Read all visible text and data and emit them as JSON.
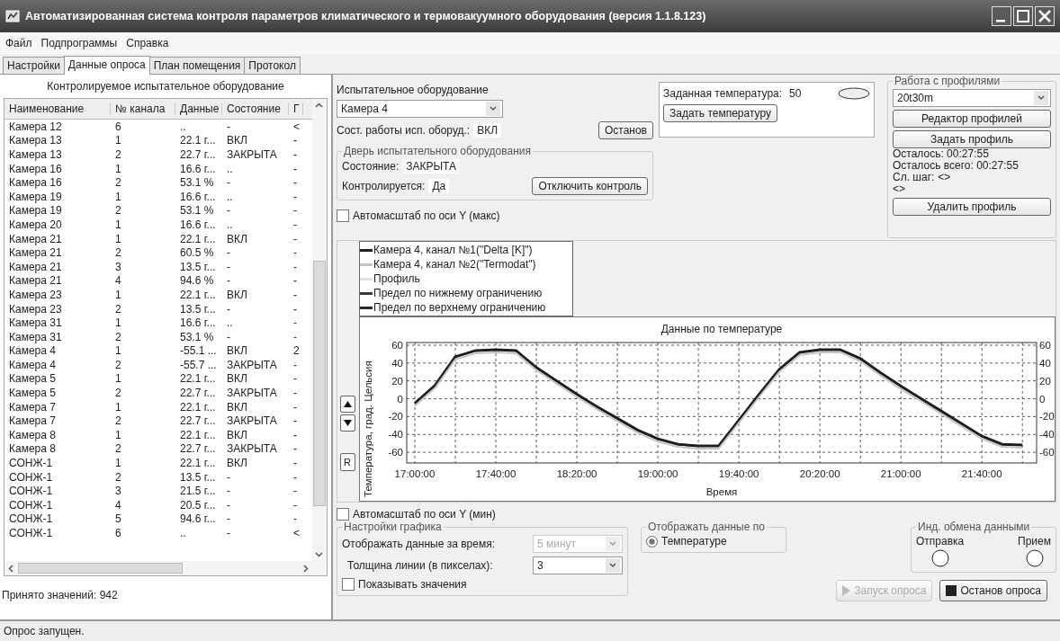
{
  "window": {
    "title": "Автоматизированная система контроля параметров климатического и термовакуумного оборудования (версия 1.1.8.123)"
  },
  "menu": [
    {
      "label": "Файл"
    },
    {
      "label": "Подпрограммы"
    },
    {
      "label": "Справка"
    }
  ],
  "tabs": [
    {
      "label": "Настройки",
      "selected": false
    },
    {
      "label": "Данные опроса",
      "selected": true
    },
    {
      "label": "План помещения",
      "selected": false
    },
    {
      "label": "Протокол",
      "selected": false
    }
  ],
  "equipment_list": {
    "title": "Контролируемое испытательное оборудование",
    "columns": [
      "Наименование",
      "№ канала",
      "Данные",
      "Состояние",
      "Г"
    ],
    "rows": [
      [
        "Камера 12",
        "6",
        "..",
        "-",
        "<"
      ],
      [
        "Камера 13",
        "1",
        "22.1 г...",
        "ВКЛ",
        "-"
      ],
      [
        "Камера 13",
        "2",
        "22.7 г...",
        "ЗАКРЫТА",
        "-"
      ],
      [
        "Камера 16",
        "1",
        "16.6 г...",
        "..",
        "-"
      ],
      [
        "Камера 16",
        "2",
        "53.1 %",
        "-",
        "-"
      ],
      [
        "Камера 19",
        "1",
        "16.6 г...",
        "..",
        "-"
      ],
      [
        "Камера 19",
        "2",
        "53.1 %",
        "-",
        "-"
      ],
      [
        "Камера 20",
        "1",
        "16.6 г...",
        "..",
        "-"
      ],
      [
        "Камера 21",
        "1",
        "22.1 г...",
        "ВКЛ",
        "-"
      ],
      [
        "Камера 21",
        "2",
        "60.5 %",
        "-",
        "-"
      ],
      [
        "Камера 21",
        "3",
        "13.5 г...",
        "-",
        "-"
      ],
      [
        "Камера 21",
        "4",
        "94.6 %",
        "-",
        "-"
      ],
      [
        "Камера 23",
        "1",
        "22.1 г...",
        "ВКЛ",
        "-"
      ],
      [
        "Камера 23",
        "2",
        "13.5 г...",
        "-",
        "-"
      ],
      [
        "Камера 31",
        "1",
        "16.6 г...",
        "..",
        "-"
      ],
      [
        "Камера 31",
        "2",
        "53.1 %",
        "-",
        "-"
      ],
      [
        "Камера 4",
        "1",
        "-55.1 ...",
        "ВКЛ",
        "2"
      ],
      [
        "Камера 4",
        "2",
        "-55.7 ...",
        "ЗАКРЫТА",
        "-"
      ],
      [
        "Камера 5",
        "1",
        "22.1 г...",
        "ВКЛ",
        "-"
      ],
      [
        "Камера 5",
        "2",
        "22.7 г...",
        "ЗАКРЫТА",
        "-"
      ],
      [
        "Камера 7",
        "1",
        "22.1 г...",
        "ВКЛ",
        "-"
      ],
      [
        "Камера 7",
        "2",
        "22.7 г...",
        "ЗАКРЫТА",
        "-"
      ],
      [
        "Камера 8",
        "1",
        "22.1 г...",
        "ВКЛ",
        "-"
      ],
      [
        "Камера 8",
        "2",
        "22.7 г...",
        "ЗАКРЫТА",
        "-"
      ],
      [
        "СОНЖ-1",
        "1",
        "22.1 г...",
        "ВКЛ",
        "-"
      ],
      [
        "СОНЖ-1",
        "2",
        "13.5 г...",
        "-",
        "-"
      ],
      [
        "СОНЖ-1",
        "3",
        "21.5 г...",
        "-",
        "-"
      ],
      [
        "СОНЖ-1",
        "4",
        "20.5 г...",
        "-",
        "-"
      ],
      [
        "СОНЖ-1",
        "5",
        "94.6 г...",
        "-",
        "-"
      ],
      [
        "СОНЖ-1",
        "6",
        "..",
        "-",
        "<"
      ]
    ],
    "received": "Принято значений: 942"
  },
  "equipment": {
    "label": "Испытательное оборудование",
    "selected_value": "Камера 4",
    "work_state_label": "Сост. работы исп. оборуд.:",
    "work_state": "ВКЛ",
    "stop_button": "Останов",
    "door": {
      "title": "Дверь испытательного оборудования",
      "state_label": "Состояние:",
      "state": "ЗАКРЫТА",
      "controlled_label": "Контролируется:",
      "controlled": "Да",
      "button": "Отключить контроль"
    }
  },
  "temperature": {
    "label": "Заданная температура:",
    "value": "50",
    "indicator_lit": false,
    "button": "Задать температуру"
  },
  "profiles": {
    "title": "Работа с профилями",
    "selected_value": "20t30m",
    "editor_button": "Редактор профилей",
    "set_button": "Задать профиль",
    "remaining": "Осталось: 00:27:55",
    "remaining_total": "Осталось всего: 00:27:55",
    "next_step_label": "Сл. шаг:",
    "next_step": "<>",
    "next_step_2": "<>",
    "delete_button": "Удалить профиль"
  },
  "autoscale_max": {
    "label": "Автомасштаб по оси Y (макс)",
    "checked": false
  },
  "chart": {
    "reset_button": "R",
    "left_ticks": [
      "60",
      "40",
      "20",
      "0",
      "-20",
      "-40",
      "-60"
    ],
    "right_ticks": [
      "60",
      "40",
      "20",
      "0",
      "-20",
      "-40",
      "-60"
    ],
    "legend": [
      {
        "label": "Профиль",
        "color": "#e2e2e2"
      },
      {
        "label": "Предел по нижнему ограничению",
        "color": "#3a3a3a"
      },
      {
        "label": "Предел по верхнему ограничению",
        "color": "#2a2a2a"
      }
    ],
    "chart_data": {
      "type": "line",
      "title": "Данные по температуре",
      "xlabel": "Время",
      "ylabel": "Температура, град. Цельсия",
      "categories": [
        "17:00:00",
        null,
        null,
        null,
        "17:40:00",
        null,
        null,
        null,
        "18:20:00",
        null,
        null,
        null,
        "19:00:00",
        null,
        null,
        null,
        "19:40:00",
        null,
        null,
        null,
        "20:20:00",
        null,
        null,
        null,
        "21:00:00",
        null,
        null,
        null,
        "21:40:00",
        null,
        null
      ],
      "series": [
        {
          "name": "Камера 4, канал №1(\"Delta [K]\")",
          "color": "#1e1e1e",
          "values": [
            -5,
            15,
            47,
            54,
            55,
            54,
            35,
            20,
            5,
            -9,
            -22,
            -35,
            -45,
            -51,
            -53,
            -53,
            -24,
            5,
            33,
            52,
            55,
            55,
            45,
            29,
            14,
            0,
            -14,
            -28,
            -42,
            -51,
            -52
          ]
        },
        {
          "name": "Камера 4, канал №2(\"Termodat\")",
          "color": "#c4c4c4",
          "values": [
            -8,
            12,
            44,
            51,
            52,
            51,
            32,
            17,
            2,
            -12,
            -25,
            -38,
            -48,
            -54,
            -56,
            -56,
            -27,
            2,
            30,
            49,
            52,
            52,
            42,
            26,
            11,
            -3,
            -17,
            -31,
            -45,
            -54,
            -55
          ]
        }
      ],
      "ylim": [
        -72,
        63
      ],
      "grid": true,
      "yticks": [
        -60,
        -40,
        -20,
        0,
        20,
        40,
        60
      ]
    }
  },
  "autoscale_min": {
    "label": "Автомасштаб по оси Y (мин)",
    "checked": false
  },
  "graph_settings": {
    "title": "Настройки графика",
    "period_label": "Отображать данные за время:",
    "period_value": "5 минут",
    "period_disabled": true,
    "width_label": "Толщина линии (в пикселах):",
    "width_value": "3",
    "show_values": {
      "label": "Показывать значения",
      "checked": false
    }
  },
  "display_by": {
    "title": "Отображать данные по",
    "options": [
      {
        "label": "Температуре",
        "selected": true
      }
    ]
  },
  "exchange": {
    "title": "Инд. обмена данными",
    "indicators": [
      {
        "label": "Отправка",
        "lit": false
      },
      {
        "label": "Прием",
        "lit": false
      }
    ]
  },
  "poll_buttons": [
    {
      "kind": "start",
      "label": "Запуск опроса",
      "disabled": true
    },
    {
      "kind": "stop",
      "label": "Останов опроса",
      "disabled": false
    }
  ],
  "status_bar": "Опрос запущен."
}
